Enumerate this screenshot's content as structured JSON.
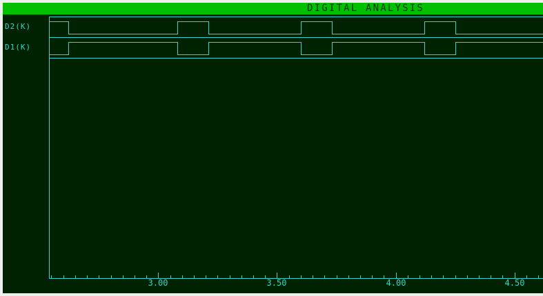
{
  "window": {
    "title": "DIGITAL ANALYSIS"
  },
  "signals": [
    {
      "name": "D2(K)",
      "initial": 1,
      "transitions": [
        2.62,
        3.08,
        3.21,
        3.6,
        3.73,
        4.12,
        4.25
      ]
    },
    {
      "name": "D1(K)",
      "initial": 0,
      "transitions": [
        2.62,
        3.08,
        3.21,
        3.6,
        3.73,
        4.12,
        4.25
      ]
    }
  ],
  "chart_data": {
    "type": "line",
    "title": "DIGITAL ANALYSIS",
    "xlim": [
      2.54,
      4.62
    ],
    "x_ticks": [
      {
        "value": 3.0,
        "label": "3.00"
      },
      {
        "value": 3.5,
        "label": "3.50"
      },
      {
        "value": 4.0,
        "label": "4.00"
      },
      {
        "value": 4.5,
        "label": "4.50"
      }
    ],
    "minor_tick_step": 0.05,
    "grid": false,
    "line_color": "#33d4cc",
    "background_color": "#002200",
    "title_bar_color": "#00c000"
  }
}
